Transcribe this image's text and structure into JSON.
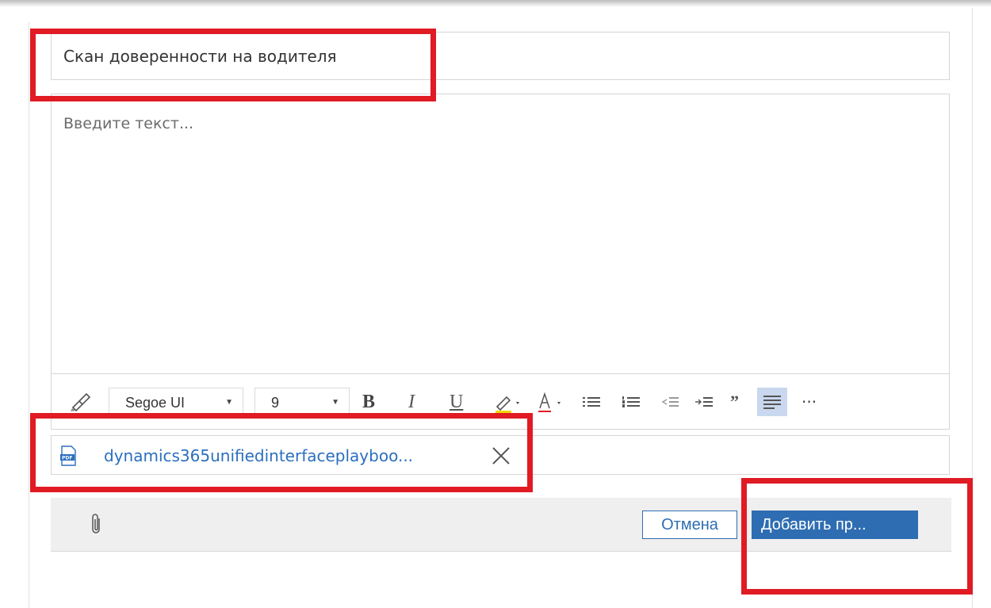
{
  "form": {
    "title_value": "Скан доверенности на водителя",
    "body_placeholder": "Введите текст..."
  },
  "toolbar": {
    "font_family": "Segoe UI",
    "font_size": "9",
    "bold_label": "B",
    "italic_label": "I",
    "underline_label": "U",
    "quote_label": "”",
    "more_label": "···",
    "icons": [
      "format-painter-icon",
      "highlight-icon",
      "font-color-icon",
      "bulleted-list-icon",
      "numbered-list-icon",
      "outdent-icon",
      "indent-icon",
      "quote-icon",
      "align-left-icon",
      "more-icon"
    ]
  },
  "attachment": {
    "file_name": "dynamics365unifiedinterfaceplayboo...",
    "icon": "pdf-file-icon"
  },
  "footer": {
    "attach_icon": "paperclip-icon",
    "cancel_label": "Отмена",
    "submit_label": "Добавить пр..."
  },
  "colors": {
    "accent": "#2e6db2",
    "highlight_box": "#e01b24",
    "active_tool": "#c9d8ee"
  }
}
